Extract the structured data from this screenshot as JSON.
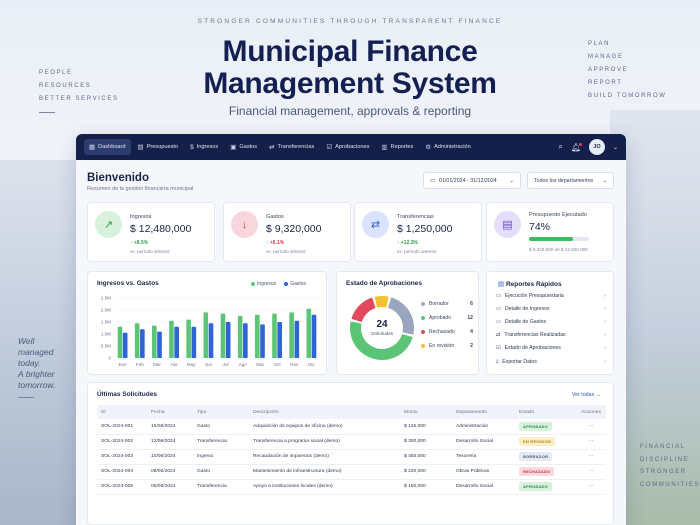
{
  "hero": {
    "tagline": "STRONGER COMMUNITIES THROUGH TRANSPARENT FINANCE",
    "title_line1": "Municipal Finance",
    "title_line2": "Management System",
    "subtitle": "Financial management, approvals & reporting"
  },
  "left_side": [
    "PEOPLE",
    "RESOURCES",
    "BETTER SERVICES"
  ],
  "right_side": [
    "PLAN",
    "MANAGE",
    "APPROVE",
    "REPORT",
    "BUILD TOMORROW"
  ],
  "quote": [
    "Well",
    "managed",
    "today.",
    "A brighter",
    "tomorrow."
  ],
  "right_bottom": [
    "FINANCIAL",
    "DISCIPLINE",
    "STRONGER",
    "COMMUNITIES"
  ],
  "nav": {
    "items": [
      {
        "label": "Dashboard",
        "icon": "grid-icon"
      },
      {
        "label": "Presupuesto",
        "icon": "document-icon"
      },
      {
        "label": "Ingresos",
        "icon": "dollar-icon"
      },
      {
        "label": "Gastos",
        "icon": "receipt-icon"
      },
      {
        "label": "Transferencias",
        "icon": "transfer-icon"
      },
      {
        "label": "Aprobaciones",
        "icon": "check-icon"
      },
      {
        "label": "Reportes",
        "icon": "report-icon"
      },
      {
        "label": "Administración",
        "icon": "gear-icon"
      }
    ],
    "avatar": "JO"
  },
  "welcome": {
    "title": "Bienvenido",
    "subtitle": "Resumen de la gestión financiera municipal",
    "date_range": "01/01/2024 - 31/12/2024",
    "department": "Todos los departamentos"
  },
  "kpis": [
    {
      "label": "Ingresos",
      "value": "$ 12,480,000",
      "delta": "+8.5%",
      "note": "vs. período anterior",
      "color": "#2e9e4f",
      "bg": "#d7f1dd",
      "arrow": "↗"
    },
    {
      "label": "Gastos",
      "value": "$ 9,320,000",
      "delta": "+6.1%",
      "note": "vs. período anterior",
      "color": "#d23b4e",
      "bg": "#f9d6dc",
      "arrow": "↓"
    },
    {
      "label": "Transferencias",
      "value": "$ 1,250,000",
      "delta": "+12.3%",
      "note": "vs. período anterior",
      "color": "#2f57c8",
      "bg": "#d9e3fb",
      "arrow": "⇄"
    },
    {
      "label": "Presupuesto Ejecutado",
      "value": "74%",
      "note": "$ 9,320,000 de $ 12,600,000",
      "progress": 0.74,
      "color": "#6b4fbf",
      "bg": "#e5defa"
    }
  ],
  "chart": {
    "title": "Ingresos vs. Gastos",
    "legend": [
      "Ingresos",
      "Gastos"
    ],
    "colors": [
      "#5cc477",
      "#2f63d8"
    ]
  },
  "chart_data": {
    "type": "bar",
    "categories": [
      "Ene",
      "Feb",
      "Mar",
      "Abr",
      "May",
      "Jun",
      "Jul",
      "Ago",
      "Sep",
      "Oct",
      "Nov",
      "Dic"
    ],
    "series": [
      {
        "name": "Ingresos",
        "values": [
          1.3,
          1.45,
          1.35,
          1.55,
          1.6,
          1.9,
          1.85,
          1.75,
          1.8,
          1.85,
          1.9,
          2.05
        ]
      },
      {
        "name": "Gastos",
        "values": [
          1.05,
          1.2,
          1.1,
          1.3,
          1.3,
          1.45,
          1.5,
          1.45,
          1.4,
          1.5,
          1.55,
          1.8
        ]
      }
    ],
    "yticks": [
      "0",
      "0.5M",
      "1.0M",
      "1.5M",
      "2.0M",
      "2.5M"
    ],
    "ylim": [
      0,
      2.5
    ]
  },
  "approvals": {
    "title": "Estado de Aprobaciones",
    "center_value": "24",
    "center_label": "Solicitudes",
    "items": [
      {
        "label": "Borrador",
        "value": 6,
        "color": "#9aa6c0"
      },
      {
        "label": "Aprobado",
        "value": 12,
        "color": "#5cc477"
      },
      {
        "label": "Rechazado",
        "value": 4,
        "color": "#e04a5c"
      },
      {
        "label": "En revisión",
        "value": 2,
        "color": "#f2c230"
      }
    ]
  },
  "reports": {
    "title": "Reportes Rápidos",
    "items": [
      "Ejecución Presupuestaria",
      "Detalle de Ingresos",
      "Detalle de Gastos",
      "Transferencias Realizadas",
      "Estado de Aprobaciones",
      "Exportar Datos"
    ]
  },
  "requests": {
    "title": "Últimas Solicitudes",
    "view_all": "Ver todas →",
    "headers": [
      "ID",
      "Fecha",
      "Tipo",
      "Descripción",
      "Monto",
      "Departamento",
      "Estado",
      "Acciones"
    ],
    "rows": [
      {
        "id": "SOL-2024-001",
        "date": "15/06/2024",
        "type": "Gasto",
        "desc": "Adquisición de equipos de oficina (demo)",
        "amount": "$ 125,000",
        "dept": "Administración",
        "status": "APROBADO",
        "fg": "#2e8a45",
        "bg": "#d8f1dd"
      },
      {
        "id": "SOL-2024-002",
        "date": "12/06/2024",
        "type": "Transferencia",
        "desc": "Transferencia a programa social (demo)",
        "amount": "$ 300,000",
        "dept": "Desarrollo Social",
        "status": "EN REVISIÓN",
        "fg": "#b8800e",
        "bg": "#fbefc8"
      },
      {
        "id": "SOL-2024-003",
        "date": "10/06/2024",
        "type": "Ingreso",
        "desc": "Recaudación de impuestos (demo)",
        "amount": "$ 450,000",
        "dept": "Tesorería",
        "status": "BORRADOR",
        "fg": "#4f5b78",
        "bg": "#e5e9f1"
      },
      {
        "id": "SOL-2024-004",
        "date": "08/06/2024",
        "type": "Gasto",
        "desc": "Mantenimiento de infraestructura (demo)",
        "amount": "$ 220,000",
        "dept": "Obras Públicas",
        "status": "RECHAZADO",
        "fg": "#c4324a",
        "bg": "#f9d9de"
      },
      {
        "id": "SOL-2024-005",
        "date": "05/06/2024",
        "type": "Transferencia",
        "desc": "Apoyo a instituciones locales (demo)",
        "amount": "$ 150,000",
        "dept": "Desarrollo Social",
        "status": "APROBADO",
        "fg": "#2e8a45",
        "bg": "#d8f1dd"
      }
    ],
    "action": "···"
  }
}
